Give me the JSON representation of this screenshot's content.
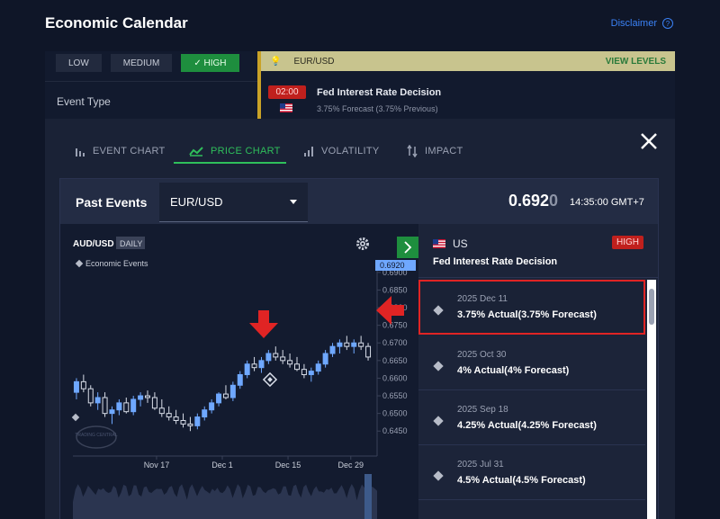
{
  "app": {
    "title": "Economic Calendar",
    "disclaimer": "Disclaimer",
    "disclaimer_icon": "help-circle-icon"
  },
  "background": {
    "importance": [
      "LOW",
      "MEDIUM",
      "HIGH"
    ],
    "importance_selected": "HIGH",
    "event_type_label": "Event Type",
    "pair": "EUR/USD",
    "view_levels": "VIEW LEVELS",
    "event_time": "02:00",
    "event_name": "Fed Interest Rate Decision",
    "event_sub": "3.75% Forecast (3.75% Previous)"
  },
  "tabs": [
    {
      "label": "EVENT CHART",
      "icon": "bar-chart-icon"
    },
    {
      "label": "PRICE CHART",
      "icon": "line-chart-icon",
      "active": true
    },
    {
      "label": "VOLATILITY",
      "icon": "signal-bars-icon"
    },
    {
      "label": "IMPACT",
      "icon": "sort-arrows-icon"
    }
  ],
  "panel": {
    "title": "Past Events",
    "pair": "EUR/USD",
    "price_main": "0.692",
    "price_dim": "0",
    "time": "14:35:00 GMT+7"
  },
  "chart": {
    "symbol": "AUD/USD",
    "interval": "DAILY",
    "legend": "Economic Events",
    "last_price_tag": "0.6920",
    "y_ticks": [
      "0.6900",
      "0.6850",
      "0.6800",
      "0.6750",
      "0.6700",
      "0.6650",
      "0.6600",
      "0.6550",
      "0.6500",
      "0.6450"
    ],
    "x_ticks": [
      "Nov 17",
      "Dec 1",
      "Dec 15",
      "Dec 29"
    ],
    "watermark": "TRADING CENTRAL"
  },
  "chart_data": {
    "type": "candlestick",
    "title": "AUD/USD",
    "interval": "DAILY",
    "ylim": [
      0.642,
      0.692
    ],
    "x_ticks": [
      "Nov 17",
      "Dec 1",
      "Dec 15",
      "Dec 29"
    ],
    "candles": [
      [
        0.656,
        0.66,
        0.654,
        0.659
      ],
      [
        0.659,
        0.661,
        0.656,
        0.657
      ],
      [
        0.657,
        0.658,
        0.652,
        0.653
      ],
      [
        0.653,
        0.656,
        0.651,
        0.6545
      ],
      [
        0.6545,
        0.656,
        0.649,
        0.65
      ],
      [
        0.65,
        0.652,
        0.647,
        0.651
      ],
      [
        0.651,
        0.654,
        0.6495,
        0.653
      ],
      [
        0.653,
        0.6545,
        0.65,
        0.6505
      ],
      [
        0.6505,
        0.655,
        0.6495,
        0.654
      ],
      [
        0.654,
        0.656,
        0.652,
        0.655
      ],
      [
        0.655,
        0.6565,
        0.653,
        0.6545
      ],
      [
        0.6545,
        0.656,
        0.651,
        0.6515
      ],
      [
        0.6515,
        0.654,
        0.649,
        0.65
      ],
      [
        0.65,
        0.652,
        0.648,
        0.649
      ],
      [
        0.649,
        0.651,
        0.647,
        0.648
      ],
      [
        0.648,
        0.65,
        0.646,
        0.647
      ],
      [
        0.647,
        0.649,
        0.645,
        0.6465
      ],
      [
        0.6465,
        0.65,
        0.6455,
        0.649
      ],
      [
        0.649,
        0.652,
        0.648,
        0.651
      ],
      [
        0.651,
        0.654,
        0.65,
        0.653
      ],
      [
        0.653,
        0.656,
        0.652,
        0.6555
      ],
      [
        0.6555,
        0.658,
        0.654,
        0.6545
      ],
      [
        0.6545,
        0.659,
        0.6535,
        0.658
      ],
      [
        0.658,
        0.662,
        0.657,
        0.661
      ],
      [
        0.661,
        0.665,
        0.66,
        0.664
      ],
      [
        0.664,
        0.666,
        0.662,
        0.663
      ],
      [
        0.663,
        0.666,
        0.6615,
        0.665
      ],
      [
        0.665,
        0.668,
        0.664,
        0.667
      ],
      [
        0.667,
        0.669,
        0.665,
        0.666
      ],
      [
        0.666,
        0.668,
        0.664,
        0.665
      ],
      [
        0.665,
        0.667,
        0.663,
        0.664
      ],
      [
        0.664,
        0.666,
        0.662,
        0.6625
      ],
      [
        0.6625,
        0.664,
        0.66,
        0.661
      ],
      [
        0.661,
        0.663,
        0.659,
        0.662
      ],
      [
        0.662,
        0.665,
        0.661,
        0.664
      ],
      [
        0.664,
        0.668,
        0.663,
        0.667
      ],
      [
        0.667,
        0.67,
        0.666,
        0.669
      ],
      [
        0.669,
        0.671,
        0.667,
        0.67
      ],
      [
        0.67,
        0.672,
        0.668,
        0.669
      ],
      [
        0.669,
        0.671,
        0.667,
        0.67
      ],
      [
        0.67,
        0.672,
        0.668,
        0.669
      ],
      [
        0.669,
        0.67,
        0.665,
        0.666
      ]
    ],
    "events_marked": [
      "Fed Interest Rate Decision"
    ]
  },
  "events": {
    "country": "US",
    "country_flag": "us-flag-icon",
    "importance": "HIGH",
    "title": "Fed Interest Rate Decision",
    "items": [
      {
        "date": "2025 Dec 11",
        "value": "3.75% Actual(3.75% Forecast)",
        "selected": true
      },
      {
        "date": "2025 Oct 30",
        "value": "4% Actual(4% Forecast)"
      },
      {
        "date": "2025 Sep 18",
        "value": "4.25% Actual(4.25% Forecast)"
      },
      {
        "date": "2025 Jul 31",
        "value": "4.5% Actual(4.5% Forecast)"
      }
    ]
  },
  "colors": {
    "accent": "#2fbf5b",
    "alert": "#e02424",
    "up": "#6fa8ff",
    "down": "#d8dde8"
  }
}
